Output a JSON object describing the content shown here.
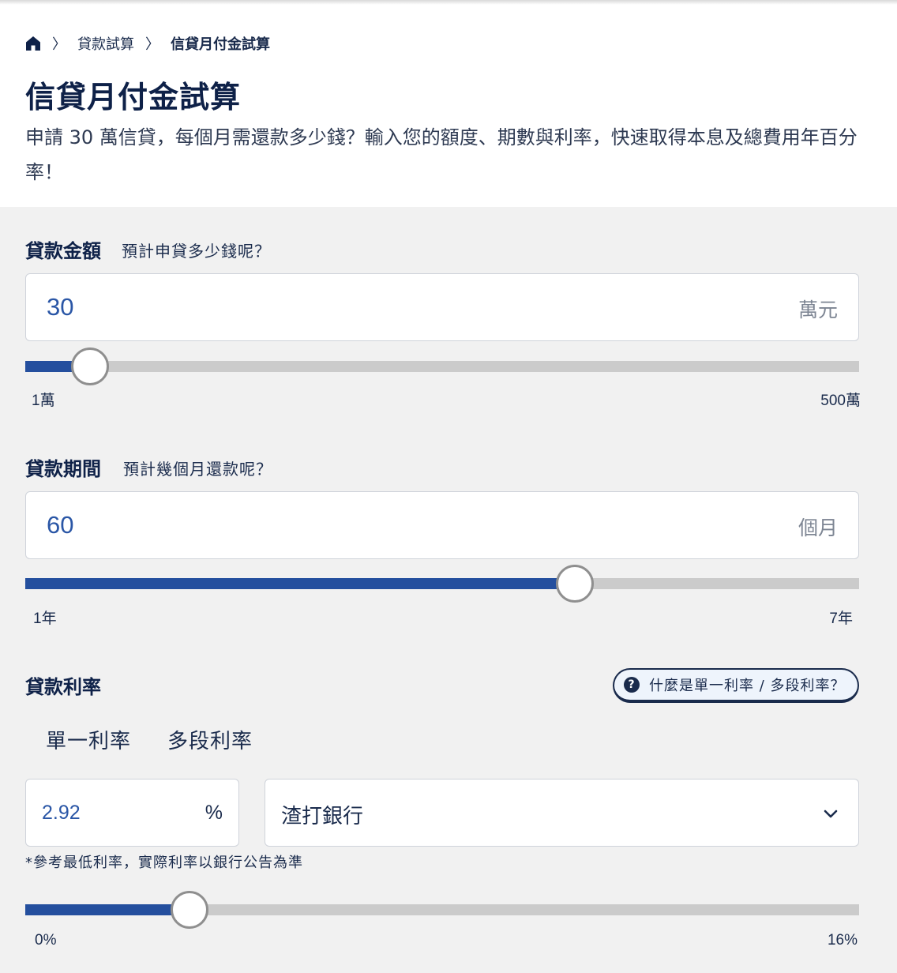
{
  "breadcrumb": {
    "home_icon": "home-icon",
    "separator": "〉",
    "items": [
      "貸款試算",
      "信貸月付金試算"
    ]
  },
  "page": {
    "title": "信貸月付金試算",
    "intro": "申請 30 萬信貸，每個月需還款多少錢？輸入您的額度、期數與利率，快速取得本息及總費用年百分率！"
  },
  "amount": {
    "label": "貸款金額",
    "hint": "預計申貸多少錢呢？",
    "value": "30",
    "unit": "萬元",
    "min_label": "1萬",
    "max_label": "500萬",
    "slider_fraction": 0.078
  },
  "period": {
    "label": "貸款期間",
    "hint": "預計幾個月還款呢？",
    "value": "60",
    "unit": "個月",
    "min_label": "1年",
    "max_label": "7年",
    "slider_fraction": 0.659
  },
  "rate": {
    "label": "貸款利率",
    "help_button": "什麼是單一利率 / 多段利率？",
    "help_icon": "question-circle-icon",
    "tabs": [
      "單一利率",
      "多段利率"
    ],
    "value": "2.92",
    "unit": "%",
    "bank": "渣打銀行",
    "bank_chevron_icon": "chevron-down-icon",
    "note": "*參考最低利率，實際利率以銀行公告為準",
    "min_label": "0%",
    "max_label": "16%",
    "slider_fraction": 0.197
  },
  "colors": {
    "navy": "#0e2148",
    "accent_blue": "#244f9e",
    "track_gray": "#cbcbcb",
    "form_bg": "#f1f1f1"
  }
}
